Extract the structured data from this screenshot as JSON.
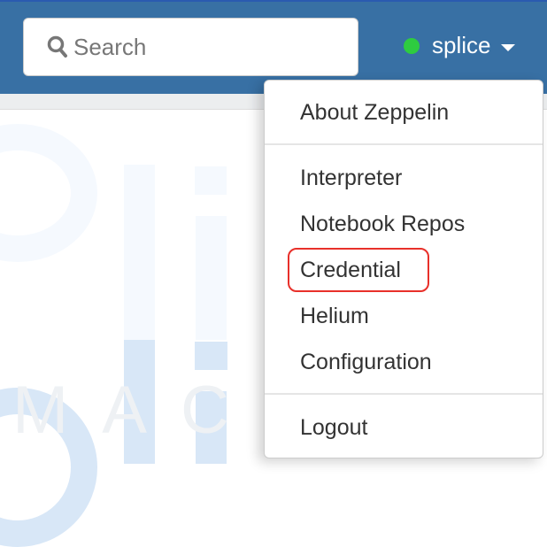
{
  "navbar": {
    "search_placeholder": "Search",
    "user_name": "splice",
    "status_color": "#2ecc40"
  },
  "dropdown": {
    "items": [
      {
        "label": "About Zeppelin"
      },
      {
        "label": "Interpreter"
      },
      {
        "label": "Notebook Repos"
      },
      {
        "label": "Credential",
        "highlighted": true
      },
      {
        "label": "Helium"
      },
      {
        "label": "Configuration"
      },
      {
        "label": "Logout"
      }
    ],
    "highlight_color": "#e8302a"
  },
  "watermark": {
    "text": "MAC"
  }
}
